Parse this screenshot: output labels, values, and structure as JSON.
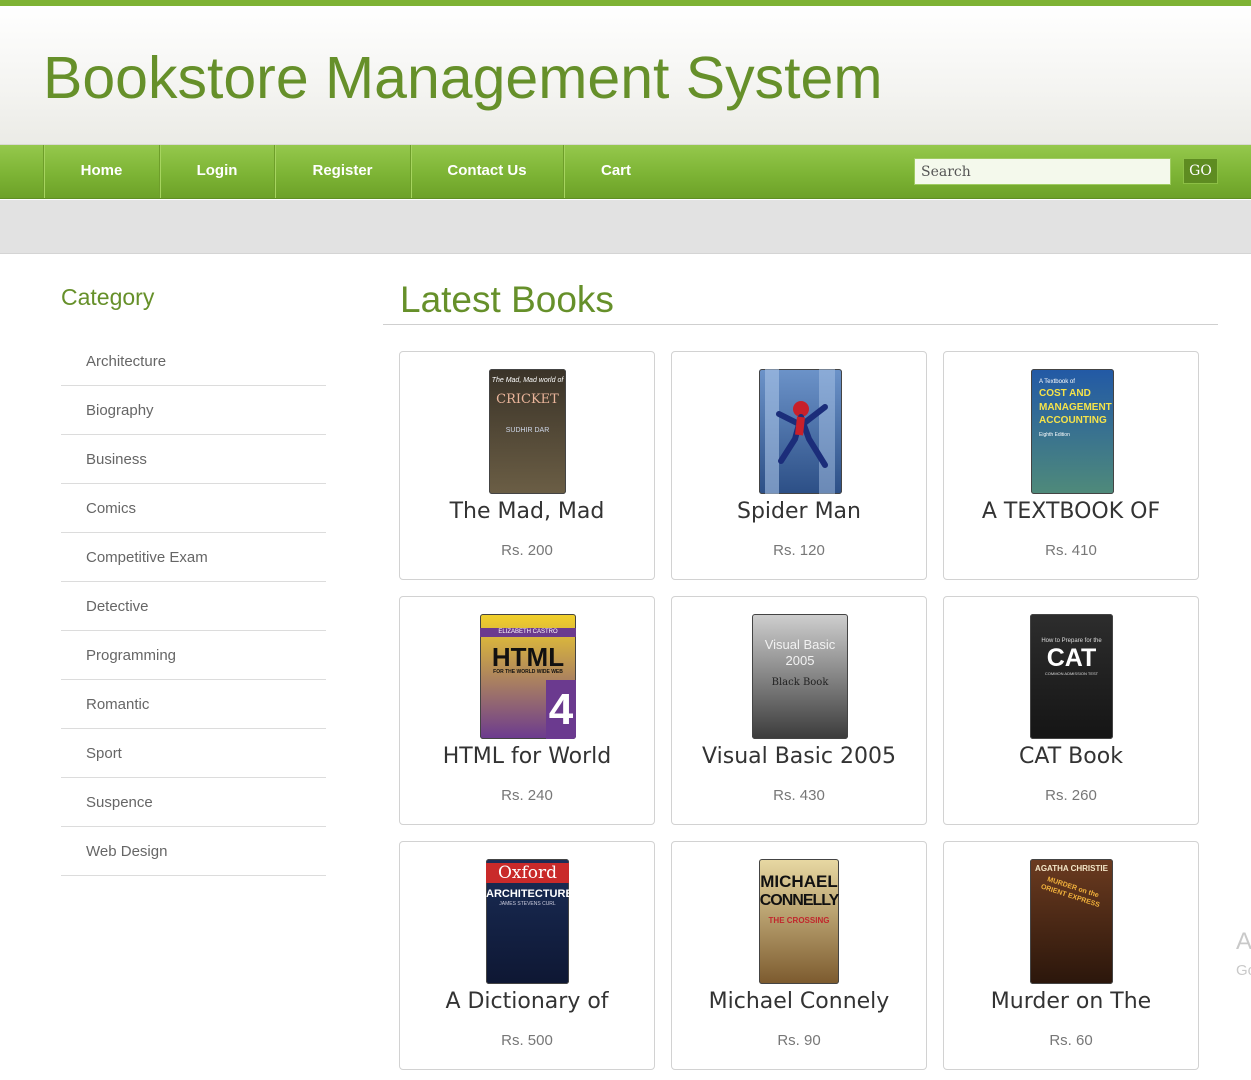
{
  "header": {
    "title": "Bookstore Management System"
  },
  "nav": {
    "items": [
      {
        "label": "Home"
      },
      {
        "label": "Login"
      },
      {
        "label": "Register"
      },
      {
        "label": "Contact Us"
      },
      {
        "label": "Cart"
      }
    ],
    "search_placeholder": "Search",
    "go_label": "GO"
  },
  "sidebar": {
    "title": "Category",
    "categories": [
      "Architecture",
      "Biography",
      "Business",
      "Comics",
      "Competitive Exam",
      "Detective",
      "Programming",
      "Romantic",
      "Sport",
      "Suspence",
      "Web Design"
    ]
  },
  "main": {
    "title": "Latest Books",
    "books": [
      {
        "title": "The Mad, Mad",
        "price": "Rs. 200",
        "cover": {
          "top": "The Mad, Mad world of",
          "main": "CRICKET",
          "sub": "SUDHIR DAR",
          "colors": [
            "#3a3328",
            "#6b5e45"
          ]
        }
      },
      {
        "title": "Spider Man",
        "price": "Rs. 120",
        "cover": {
          "top": "",
          "main": "",
          "sub": "",
          "colors": [
            "#6c93c9",
            "#2c4f86"
          ]
        }
      },
      {
        "title": "A TEXTBOOK OF",
        "price": "Rs. 410",
        "cover": {
          "top": "A Textbook of",
          "main": "COST AND MANAGEMENT ACCOUNTING",
          "sub": "Eighth Edition",
          "colors": [
            "#2259a6",
            "#4f8a7a"
          ]
        }
      },
      {
        "title": "HTML for World",
        "price": "Rs. 240",
        "cover": {
          "top": "ELIZABETH CASTRO",
          "main": "HTML",
          "sub": "FOR THE WORLD WIDE WEB",
          "colors": [
            "#f2d12a",
            "#6b3a8f"
          ]
        }
      },
      {
        "title": "Visual Basic 2005",
        "price": "Rs. 430",
        "cover": {
          "top": "Visual Basic",
          "main": "2005",
          "sub": "Black Book",
          "colors": [
            "#cfcfcf",
            "#3b3b3b"
          ]
        }
      },
      {
        "title": "CAT Book",
        "price": "Rs. 260",
        "cover": {
          "top": "How to Prepare for the",
          "main": "CAT",
          "sub": "COMMON ADMISSION TEST",
          "colors": [
            "#2d2d2d",
            "#151515"
          ]
        }
      },
      {
        "title": "A Dictionary of",
        "price": "Rs. 500",
        "cover": {
          "top": "Oxford",
          "main": "ARCHITECTURE",
          "sub": "JAMES STEVENS CURL",
          "colors": [
            "#1a2d57",
            "#0e1733"
          ]
        }
      },
      {
        "title": "Michael Connely",
        "price": "Rs. 90",
        "cover": {
          "top": "MICHAEL",
          "main": "CONNELLY",
          "sub": "THE CROSSING",
          "colors": [
            "#e8d9a3",
            "#7c5a2e"
          ]
        }
      },
      {
        "title": "Murder on The",
        "price": "Rs. 60",
        "cover": {
          "top": "AGATHA CHRISTIE",
          "main": "MURDER on the ORIENT EXPRESS",
          "sub": "",
          "colors": [
            "#6b3b20",
            "#2b160b"
          ]
        }
      }
    ]
  },
  "edge": {
    "letter": "A",
    "small": "Go"
  }
}
